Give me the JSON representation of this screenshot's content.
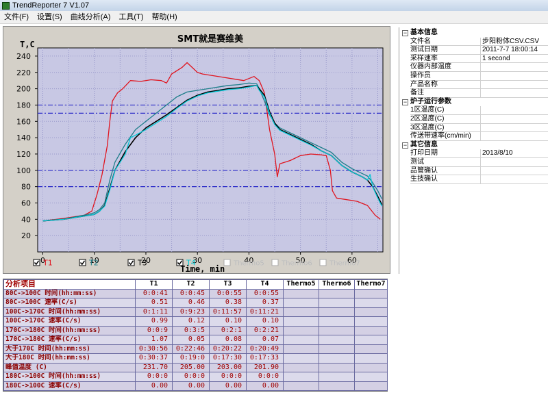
{
  "window": {
    "title": "TrendReporter 7 V1.07"
  },
  "menu": [
    "文件(F)",
    "设置(S)",
    "曲线分析(A)",
    "工具(T)",
    "帮助(H)"
  ],
  "colors": {
    "T1": "#e0141e",
    "T2": "#1e7e8a",
    "T3": "#000000",
    "T4": "#00c8d6",
    "ref_line": "#2828c8",
    "plot_bg": "#c8c8e4"
  },
  "chart_data": {
    "type": "line",
    "title": "SMT就是赛维美",
    "xlabel": "Time, min",
    "ylabel": "T,C",
    "xlim": [
      -1,
      66
    ],
    "ylim": [
      0,
      250
    ],
    "xticks": [
      0,
      10,
      20,
      30,
      40,
      50,
      60
    ],
    "yticks": [
      20,
      40,
      60,
      80,
      100,
      120,
      140,
      160,
      180,
      200,
      220,
      240
    ],
    "grid": true,
    "reference_lines": [
      180,
      170,
      100,
      80
    ],
    "legend": [
      {
        "label": "T1",
        "checked": true,
        "enabled": true
      },
      {
        "label": "T2",
        "checked": true,
        "enabled": true
      },
      {
        "label": "T3",
        "checked": true,
        "enabled": true
      },
      {
        "label": "T4",
        "checked": true,
        "enabled": true
      },
      {
        "label": "Thermo5",
        "checked": false,
        "enabled": false
      },
      {
        "label": "Thermo6",
        "checked": false,
        "enabled": false
      },
      {
        "label": "Thermo7",
        "checked": false,
        "enabled": false
      }
    ],
    "series": [
      {
        "name": "T1",
        "x": [
          0,
          4,
          8,
          9.5,
          10.5,
          11.5,
          12.5,
          13,
          13.5,
          14.5,
          15.5,
          17,
          19,
          21,
          23,
          24,
          25,
          27,
          28,
          29,
          30,
          31,
          33,
          35,
          37,
          39,
          41,
          42,
          43,
          44,
          45,
          45.5,
          46,
          48,
          50,
          52,
          54,
          55,
          55.8,
          56.2,
          57,
          59,
          61,
          63,
          64.5,
          65.5
        ],
        "y": [
          38,
          41,
          45,
          50,
          70,
          95,
          130,
          160,
          185,
          195,
          200,
          210,
          209,
          211,
          210,
          207,
          218,
          226,
          232,
          226,
          220,
          218,
          216,
          214,
          212,
          210,
          215,
          210,
          195,
          150,
          120,
          92,
          108,
          112,
          118,
          120,
          119,
          118,
          100,
          75,
          66,
          64,
          62,
          57,
          45,
          40
        ]
      },
      {
        "name": "T2",
        "x": [
          0,
          4,
          8,
          10,
          11,
          12,
          13,
          14,
          16,
          18,
          20,
          22,
          24,
          26,
          28,
          30,
          32,
          34,
          36,
          38,
          40,
          41.5,
          42,
          43,
          44,
          45,
          46,
          48,
          50,
          52,
          54,
          56,
          58,
          60,
          62,
          63,
          64,
          65,
          65.8
        ],
        "y": [
          38,
          40,
          45,
          48,
          52,
          60,
          88,
          110,
          132,
          150,
          160,
          170,
          180,
          190,
          196,
          198,
          200,
          202,
          204,
          205,
          207,
          206,
          200,
          185,
          168,
          158,
          152,
          146,
          140,
          134,
          128,
          122,
          110,
          102,
          96,
          93,
          85,
          75,
          65
        ]
      },
      {
        "name": "T3",
        "x": [
          0,
          4,
          8,
          10,
          11,
          12,
          13,
          14,
          16,
          18,
          20,
          22,
          24,
          26,
          28,
          30,
          32,
          34,
          36,
          38,
          40,
          41.5,
          42,
          43,
          44,
          45,
          46,
          48,
          50,
          52,
          54,
          56,
          58,
          60,
          62,
          63,
          64,
          65,
          65.8
        ],
        "y": [
          38,
          40,
          44,
          46,
          50,
          57,
          78,
          100,
          123,
          140,
          152,
          160,
          168,
          177,
          186,
          192,
          196,
          198,
          200,
          201,
          203,
          204,
          200,
          192,
          172,
          158,
          150,
          144,
          138,
          132,
          124,
          118,
          106,
          98,
          92,
          88,
          80,
          68,
          58
        ]
      },
      {
        "name": "T4",
        "x": [
          0,
          4,
          8,
          10,
          11,
          12,
          13,
          14,
          16,
          17,
          18,
          20,
          22,
          24,
          26,
          28,
          30,
          32,
          34,
          36,
          38,
          40,
          41.5,
          42,
          43,
          44,
          45,
          46,
          48,
          50,
          52,
          54,
          56,
          58,
          60,
          62,
          63,
          63.5,
          64,
          65,
          65.8
        ],
        "y": [
          38,
          40,
          44,
          46,
          50,
          56,
          76,
          100,
          120,
          140,
          143,
          150,
          158,
          166,
          176,
          185,
          191,
          195,
          197,
          199,
          200,
          202,
          204,
          198,
          190,
          170,
          156,
          149,
          143,
          137,
          131,
          124,
          118,
          106,
          98,
          92,
          88,
          95,
          80,
          66,
          56
        ]
      }
    ]
  },
  "info_panel": {
    "groups": [
      {
        "title": "基本信息",
        "rows": [
          {
            "key": "文件名",
            "value": "步阳粉体CSV.CSV"
          },
          {
            "key": "测试日期",
            "value": "2011-7-7 18:00:14"
          },
          {
            "key": "采样速率",
            "value": "1 second"
          },
          {
            "key": "仪器内部温度",
            "value": ""
          },
          {
            "key": "操作员",
            "value": ""
          },
          {
            "key": "产品名称",
            "value": ""
          },
          {
            "key": "备注",
            "value": ""
          }
        ]
      },
      {
        "title": "炉子运行参数",
        "rows": [
          {
            "key": "1区温度(C)",
            "value": ""
          },
          {
            "key": "2区温度(C)",
            "value": ""
          },
          {
            "key": "3区温度(C)",
            "value": ""
          },
          {
            "key": "传送带速率(cm/min)",
            "value": ""
          }
        ]
      },
      {
        "title": "其它信息",
        "rows": [
          {
            "key": "打印日期",
            "value": "2013/8/10"
          },
          {
            "key": "测试",
            "value": ""
          },
          {
            "key": "品管确认",
            "value": ""
          },
          {
            "key": "生技确认",
            "value": ""
          }
        ]
      }
    ]
  },
  "analysis_table": {
    "headers": [
      "分析项目",
      "T1",
      "T2",
      "T3",
      "T4",
      "Thermo5",
      "Thermo6",
      "Thermo7"
    ],
    "rows": [
      [
        "80C->100C 时间(hh:mm:ss)",
        "0:0:41",
        "0:0:45",
        "0:0:55",
        "0:0:55",
        "",
        "",
        ""
      ],
      [
        "80C->100C 速率(C/s)",
        "0.51",
        "0.46",
        "0.38",
        "0.37",
        "",
        "",
        ""
      ],
      [
        "100C->170C 时间(hh:mm:ss)",
        "0:1:11",
        "0:9:23",
        "0:11:57",
        "0:11:21",
        "",
        "",
        ""
      ],
      [
        "100C->170C 速率(C/s)",
        "0.99",
        "0.12",
        "0.10",
        "0.10",
        "",
        "",
        ""
      ],
      [
        "170C->180C 时间(hh:mm:ss)",
        "0:0:9",
        "0:3:5",
        "0:2:1",
        "0:2:21",
        "",
        "",
        ""
      ],
      [
        "170C->180C 速率(C/s)",
        "1.07",
        "0.05",
        "0.08",
        "0.07",
        "",
        "",
        ""
      ],
      [
        "大于170C 时间(hh:mm:ss)",
        "0:30:56",
        "0:22:46",
        "0:20:22",
        "0:20:49",
        "",
        "",
        ""
      ],
      [
        "大于180C 时间(hh:mm:ss)",
        "0:30:37",
        "0:19:0",
        "0:17:30",
        "0:17:33",
        "",
        "",
        ""
      ],
      [
        "峰值温度 (C)",
        "231.70",
        "205.00",
        "203.00",
        "201.90",
        "",
        "",
        ""
      ],
      [
        "180C->100C 时间(hh:mm:ss)",
        "0:0:0",
        "0:0:0",
        "0:0:0",
        "0:0:0",
        "",
        "",
        ""
      ],
      [
        "180C->100C 速率(C/s)",
        "0.00",
        "0.00",
        "0.00",
        "0.00",
        "",
        "",
        ""
      ]
    ]
  }
}
